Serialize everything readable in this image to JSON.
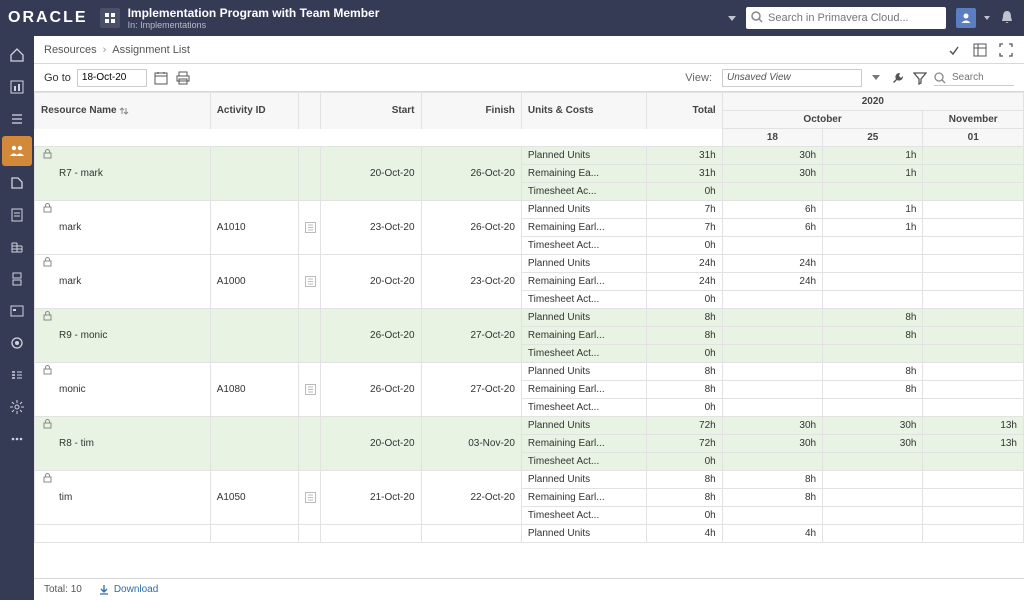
{
  "header": {
    "brand": "ORACLE",
    "title": "Implementation Program with Team Member",
    "subtitle": "In: Implementations",
    "search_placeholder": "Search in Primavera Cloud..."
  },
  "breadcrumb": {
    "a": "Resources",
    "b": "Assignment List"
  },
  "toolbar": {
    "goto_label": "Go to",
    "goto_value": "18-Oct-20",
    "view_label": "View:",
    "view_value": "Unsaved View",
    "search_placeholder": "Search"
  },
  "columns": {
    "resource_name": "Resource Name",
    "activity_id": "Activity ID",
    "start": "Start",
    "finish": "Finish",
    "units_costs": "Units & Costs",
    "total": "Total",
    "year": "2020",
    "month_oct": "October",
    "month_nov": "November",
    "d18": "18",
    "d25": "25",
    "d01": "01"
  },
  "metrics": {
    "planned": "Planned Units",
    "remaining": "Remaining Earl...",
    "remaining_short": "Remaining Ea...",
    "timesheet": "Timesheet Act...",
    "timesheet_ac": "Timesheet Ac..."
  },
  "rows": [
    {
      "type": "group",
      "name": "R7 - mark",
      "activity": "",
      "start": "20-Oct-20",
      "finish": "26-Oct-20",
      "sub": [
        {
          "uc": "Planned Units",
          "total": "31h",
          "c1": "30h",
          "c2": "1h",
          "c3": ""
        },
        {
          "uc": "Remaining Ea...",
          "total": "31h",
          "c1": "30h",
          "c2": "1h",
          "c3": ""
        },
        {
          "uc": "Timesheet Ac...",
          "total": "0h",
          "c1": "",
          "c2": "",
          "c3": ""
        }
      ]
    },
    {
      "type": "row",
      "name": "mark",
      "activity": "A1010",
      "start": "23-Oct-20",
      "finish": "26-Oct-20",
      "sub": [
        {
          "uc": "Planned Units",
          "total": "7h",
          "c1": "6h",
          "c2": "1h",
          "c3": ""
        },
        {
          "uc": "Remaining Earl...",
          "total": "7h",
          "c1": "6h",
          "c2": "1h",
          "c3": ""
        },
        {
          "uc": "Timesheet Act...",
          "total": "0h",
          "c1": "",
          "c2": "",
          "c3": ""
        }
      ]
    },
    {
      "type": "row",
      "name": "mark",
      "activity": "A1000",
      "start": "20-Oct-20",
      "finish": "23-Oct-20",
      "sub": [
        {
          "uc": "Planned Units",
          "total": "24h",
          "c1": "24h",
          "c2": "",
          "c3": ""
        },
        {
          "uc": "Remaining Earl...",
          "total": "24h",
          "c1": "24h",
          "c2": "",
          "c3": ""
        },
        {
          "uc": "Timesheet Act...",
          "total": "0h",
          "c1": "",
          "c2": "",
          "c3": ""
        }
      ]
    },
    {
      "type": "group",
      "name": "R9 - monic",
      "activity": "",
      "start": "26-Oct-20",
      "finish": "27-Oct-20",
      "sub": [
        {
          "uc": "Planned Units",
          "total": "8h",
          "c1": "",
          "c2": "8h",
          "c3": ""
        },
        {
          "uc": "Remaining Earl...",
          "total": "8h",
          "c1": "",
          "c2": "8h",
          "c3": ""
        },
        {
          "uc": "Timesheet Act...",
          "total": "0h",
          "c1": "",
          "c2": "",
          "c3": ""
        }
      ]
    },
    {
      "type": "row",
      "name": "monic",
      "activity": "A1080",
      "start": "26-Oct-20",
      "finish": "27-Oct-20",
      "sub": [
        {
          "uc": "Planned Units",
          "total": "8h",
          "c1": "",
          "c2": "8h",
          "c3": ""
        },
        {
          "uc": "Remaining Earl...",
          "total": "8h",
          "c1": "",
          "c2": "8h",
          "c3": ""
        },
        {
          "uc": "Timesheet Act...",
          "total": "0h",
          "c1": "",
          "c2": "",
          "c3": ""
        }
      ]
    },
    {
      "type": "group",
      "name": "R8 - tim",
      "activity": "",
      "start": "20-Oct-20",
      "finish": "03-Nov-20",
      "sub": [
        {
          "uc": "Planned Units",
          "total": "72h",
          "c1": "30h",
          "c2": "30h",
          "c3": "13h"
        },
        {
          "uc": "Remaining Earl...",
          "total": "72h",
          "c1": "30h",
          "c2": "30h",
          "c3": "13h"
        },
        {
          "uc": "Timesheet Act...",
          "total": "0h",
          "c1": "",
          "c2": "",
          "c3": ""
        }
      ]
    },
    {
      "type": "row",
      "name": "tim",
      "activity": "A1050",
      "start": "21-Oct-20",
      "finish": "22-Oct-20",
      "sub": [
        {
          "uc": "Planned Units",
          "total": "8h",
          "c1": "8h",
          "c2": "",
          "c3": ""
        },
        {
          "uc": "Remaining Earl...",
          "total": "8h",
          "c1": "8h",
          "c2": "",
          "c3": ""
        },
        {
          "uc": "Timesheet Act...",
          "total": "0h",
          "c1": "",
          "c2": "",
          "c3": ""
        }
      ]
    },
    {
      "type": "partial",
      "name": "",
      "activity": "",
      "start": "",
      "finish": "",
      "sub": [
        {
          "uc": "Planned Units",
          "total": "4h",
          "c1": "4h",
          "c2": "",
          "c3": ""
        }
      ]
    }
  ],
  "footer": {
    "total_label": "Total:",
    "total_value": "10",
    "download": "Download"
  }
}
